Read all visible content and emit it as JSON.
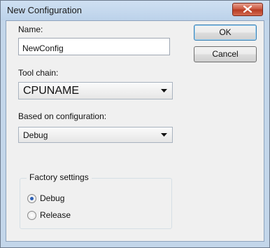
{
  "window": {
    "title": "New Configuration"
  },
  "name_field": {
    "label": "Name:",
    "value": "NewConfig"
  },
  "toolchain": {
    "label": "Tool chain:",
    "selected": "CPUNAME"
  },
  "based_on": {
    "label": "Based on configuration:",
    "selected": "Debug"
  },
  "factory_settings": {
    "label": "Factory settings",
    "options": [
      {
        "label": "Debug",
        "selected": true
      },
      {
        "label": "Release",
        "selected": false
      }
    ]
  },
  "buttons": {
    "ok": "OK",
    "cancel": "Cancel"
  },
  "colors": {
    "frame": "#c3d6ea",
    "close_button": "#c8523a",
    "client_bg": "#f0f0f0",
    "radio_selected": "#2c5fb5"
  },
  "icons": {
    "close": "close-icon",
    "dropdown": "chevron-down-icon"
  }
}
